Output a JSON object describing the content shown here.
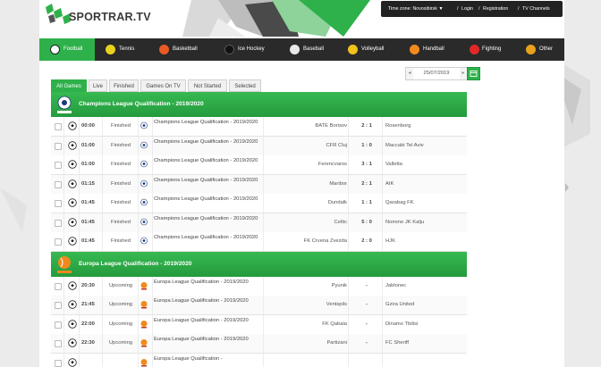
{
  "site": {
    "logo_text": "SPORTRAR.TV"
  },
  "userbar": {
    "timezone": "Time zone: Novosibirsk ▼",
    "sep1": "/",
    "login": "Login",
    "sep2": "/",
    "registration": "Registration",
    "sep3": "/",
    "channels": "TV Channels"
  },
  "nav": [
    {
      "label": "Football",
      "icon": "football-icon",
      "color": "#ffffff"
    },
    {
      "label": "Tennis",
      "icon": "tennis-icon",
      "color": "#e8d21c"
    },
    {
      "label": "Basketball",
      "icon": "basketball-icon",
      "color": "#e85b22"
    },
    {
      "label": "Ice Hockey",
      "icon": "hockey-puck-icon",
      "color": "#111111"
    },
    {
      "label": "Baseball",
      "icon": "baseball-icon",
      "color": "#e8e8e8"
    },
    {
      "label": "Volleyball",
      "icon": "volleyball-icon",
      "color": "#f0c21c"
    },
    {
      "label": "Handball",
      "icon": "handball-icon",
      "color": "#f08a1c"
    },
    {
      "label": "Fighting",
      "icon": "glove-icon",
      "color": "#e02828"
    },
    {
      "label": "Other",
      "icon": "trophy-icon",
      "color": "#e8a21c"
    }
  ],
  "date": {
    "value": "25/07/2019",
    "prev": "◂",
    "next": "▸"
  },
  "filters": [
    "All Games",
    "Live",
    "Finished",
    "Games On TV",
    "Not Started",
    "Selected"
  ],
  "leagues": [
    {
      "title": "Champions League Qualification - 2019/2020",
      "icon": "champions-league-icon",
      "matches": [
        {
          "time": "00:00",
          "status": "Finished",
          "competition": "Champions League Qualification - 2019/2020",
          "home": "BATE Borisov",
          "score": "2 : 1",
          "away": "Rosenborg"
        },
        {
          "time": "01:00",
          "status": "Finished",
          "competition": "Champions League Qualification - 2019/2020",
          "home": "CFR Cluj",
          "score": "1 : 0",
          "away": "Maccabi Tel Aviv"
        },
        {
          "time": "01:00",
          "status": "Finished",
          "competition": "Champions League Qualification - 2019/2020",
          "home": "Ferencvaros",
          "score": "3 : 1",
          "away": "Valletta"
        },
        {
          "time": "01:15",
          "status": "Finished",
          "competition": "Champions League Qualification - 2019/2020",
          "home": "Maribor",
          "score": "2 : 1",
          "away": "AIK"
        },
        {
          "time": "01:45",
          "status": "Finished",
          "competition": "Champions League Qualification - 2019/2020",
          "home": "Dundalk",
          "score": "1 : 1",
          "away": "Qarabag FK"
        },
        {
          "time": "01:45",
          "status": "Finished",
          "competition": "Champions League Qualification - 2019/2020",
          "home": "Celtic",
          "score": "5 : 0",
          "away": "Nomme JK Kalju"
        },
        {
          "time": "01:45",
          "status": "Finished",
          "competition": "Champions League Qualification - 2019/2020",
          "home": "FK Crvena Zvezda",
          "score": "2 : 0",
          "away": "HJK"
        }
      ]
    },
    {
      "title": "Europa League Qualification - 2019/2020",
      "icon": "europa-league-icon",
      "matches": [
        {
          "time": "20:30",
          "status": "Upcoming",
          "competition": "Europa League Qualification - 2019/2020",
          "home": "Pyunik",
          "score": "-",
          "away": "Jablonec"
        },
        {
          "time": "21:45",
          "status": "Upcoming",
          "competition": "Europa League Qualification - 2019/2020",
          "home": "Ventspils",
          "score": "-",
          "away": "Gzira United"
        },
        {
          "time": "22:00",
          "status": "Upcoming",
          "competition": "Europa League Qualification - 2019/2020",
          "home": "FK Qabala",
          "score": "-",
          "away": "Dinamo Tbilisi"
        },
        {
          "time": "22:30",
          "status": "Upcoming",
          "competition": "Europa League Qualification - 2019/2020",
          "home": "Partizani",
          "score": "-",
          "away": "FC Sheriff"
        },
        {
          "time": "",
          "status": "",
          "competition": "Europa League Qualification -",
          "home": "",
          "score": "",
          "away": ""
        }
      ]
    }
  ],
  "colors": {
    "accent": "#2eb14a",
    "nav_bg": "#2a2a2a",
    "page_bg": "#ebebeb"
  }
}
